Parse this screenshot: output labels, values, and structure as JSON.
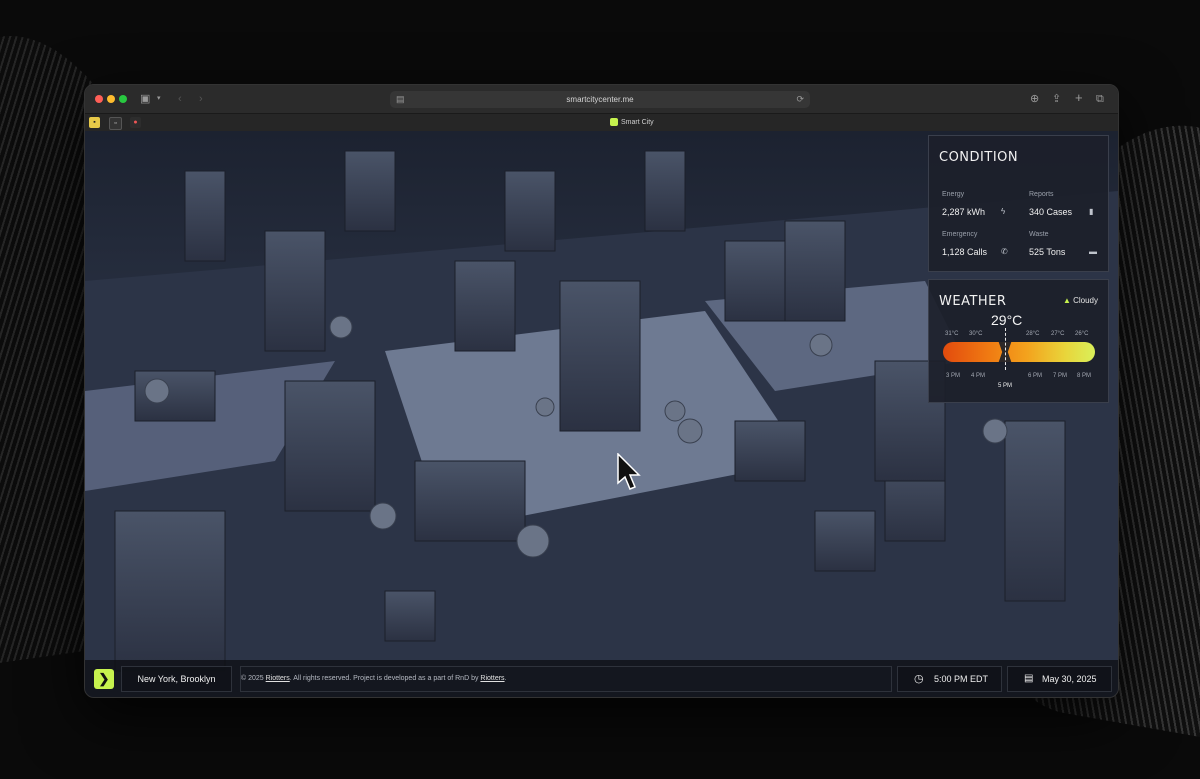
{
  "browser": {
    "url": "smartcitycenter.me",
    "tab_title": "Smart City"
  },
  "condition": {
    "title": "CONDITION",
    "metrics": [
      {
        "label": "Energy",
        "value": "2,287 kWh",
        "icon": "bolt-icon"
      },
      {
        "label": "Reports",
        "value": "340 Cases",
        "icon": "document-icon"
      },
      {
        "label": "Emergency",
        "value": "1,128 Calls",
        "icon": "phone-icon"
      },
      {
        "label": "Waste",
        "value": "525 Tons",
        "icon": "trash-icon"
      }
    ]
  },
  "weather": {
    "title": "WEATHER",
    "condition": "Cloudy",
    "current_temp": "29°C",
    "temps": [
      "31°C",
      "30°C",
      "28°C",
      "27°C",
      "26°C"
    ],
    "times": [
      "3 PM",
      "4 PM",
      "6 PM",
      "7 PM",
      "8 PM"
    ],
    "now_time": "5 PM",
    "colors": {
      "hot": "#e24b0e",
      "mild": "#d9f05a"
    }
  },
  "footer": {
    "location": "New York, Brooklyn",
    "copyright_prefix": "© 2025",
    "copyright_brand": "Riotters",
    "copyright_mid": ". All rights reserved. Project is developed as a part of RnD by",
    "copyright_brand2": "Riotters",
    "copyright_end": ".",
    "time": "5:00 PM EDT",
    "date": "May 30, 2025"
  },
  "accent_color": "#c6f24e"
}
